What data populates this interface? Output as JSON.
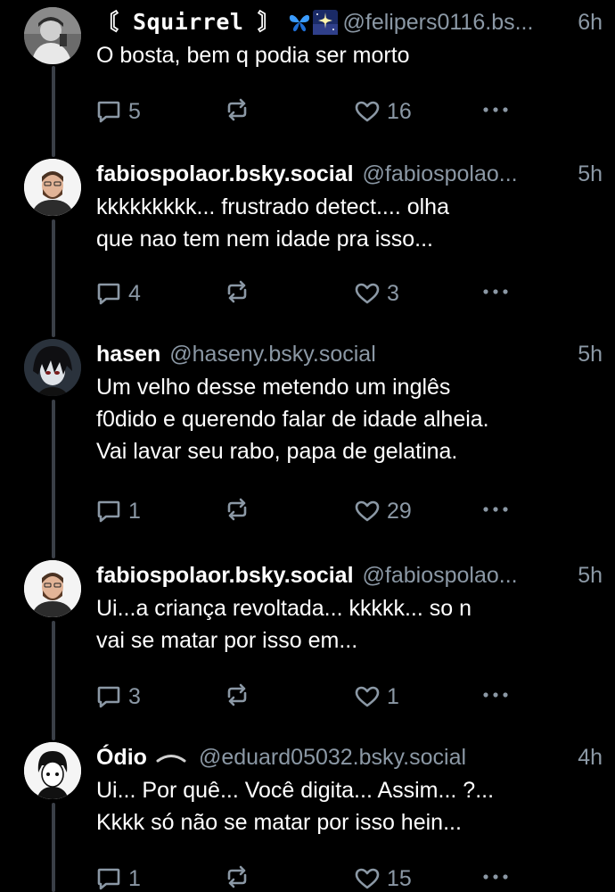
{
  "posts": [
    {
      "display_name": "〘 Squirrel 〙",
      "handle": "@felipers0116.bs...",
      "time": "6h",
      "text": "O bosta, bem q podia ser morto",
      "replies": "5",
      "likes": "16",
      "avatar": "person-photo"
    },
    {
      "display_name": "fabiospolaor.bsky.social",
      "handle": "@fabiospolao...",
      "time": "5h",
      "text": "kkkkkkkkk... frustrado detect.... olha\nque nao tem nem idade pra isso...",
      "replies": "4",
      "likes": "3",
      "avatar": "bearded-man"
    },
    {
      "display_name": "hasen",
      "handle": "@haseny.bsky.social",
      "time": "5h",
      "text": "Um velho desse metendo um inglês\nf0dido e querendo falar de idade alheia.\nVai lavar seu rabo, papa de gelatina.",
      "replies": "1",
      "likes": "29",
      "avatar": "anime-character"
    },
    {
      "display_name": "fabiospolaor.bsky.social",
      "handle": "@fabiospolao...",
      "time": "5h",
      "text": "Ui...a criança revoltada... kkkkk... so n\nvai se matar por isso em...",
      "replies": "3",
      "likes": "1",
      "avatar": "bearded-man"
    },
    {
      "display_name": "Ódio",
      "handle": "@eduard05032.bsky.social",
      "time": "4h",
      "text": "Ui... Por quê... Você digita... Assim... ?...\nKkkk só não se matar por isso hein...",
      "replies": "1",
      "likes": "15",
      "avatar": "manga-character"
    }
  ],
  "icons": {
    "reply": "speech-bubble-icon",
    "repost": "repost-arrows-icon",
    "like": "heart-icon",
    "more": "ellipsis-icon",
    "name_decoration": [
      "butterfly-emoji",
      "sparkle-night-emoji"
    ]
  },
  "colors": {
    "background": "#000000",
    "text": "#ffffff",
    "muted": "#8b98a5",
    "thread_line": "#3a3f47"
  }
}
